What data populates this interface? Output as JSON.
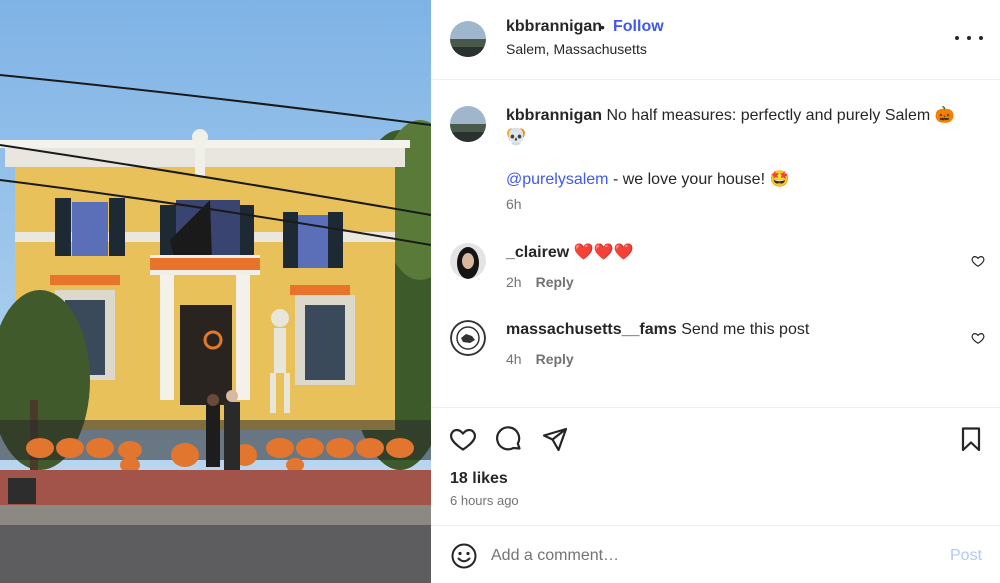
{
  "post": {
    "username": "kbbrannigan",
    "separator": "•",
    "follow_label": "Follow",
    "location": "Salem, Massachusetts"
  },
  "caption": {
    "username": "kbbrannigan",
    "text": "No half measures: perfectly and purely Salem 🎃 🧡",
    "text_line2": "💀",
    "mention": "@purelysalem",
    "mention_suffix": " - we love your house! 🤩",
    "time": "6h"
  },
  "comments": [
    {
      "username": "_clairew",
      "text": "❤️❤️❤️",
      "time": "2h",
      "reply_label": "Reply"
    },
    {
      "username": "massachusetts__fams",
      "text": "Send me this post",
      "time": "4h",
      "reply_label": "Reply"
    }
  ],
  "stats": {
    "likes": "18 likes",
    "time_ago": "6 hours ago"
  },
  "composer": {
    "placeholder": "Add a comment…",
    "post_label": "Post"
  },
  "icons": {
    "more": "more-options-icon",
    "like": "heart-icon",
    "comment": "comment-icon",
    "share": "share-icon",
    "save": "bookmark-icon",
    "emoji": "emoji-icon"
  },
  "colors": {
    "accent": "#3f58f0",
    "post_disabled": "#b2c9f7",
    "secondary_text": "#737373"
  }
}
